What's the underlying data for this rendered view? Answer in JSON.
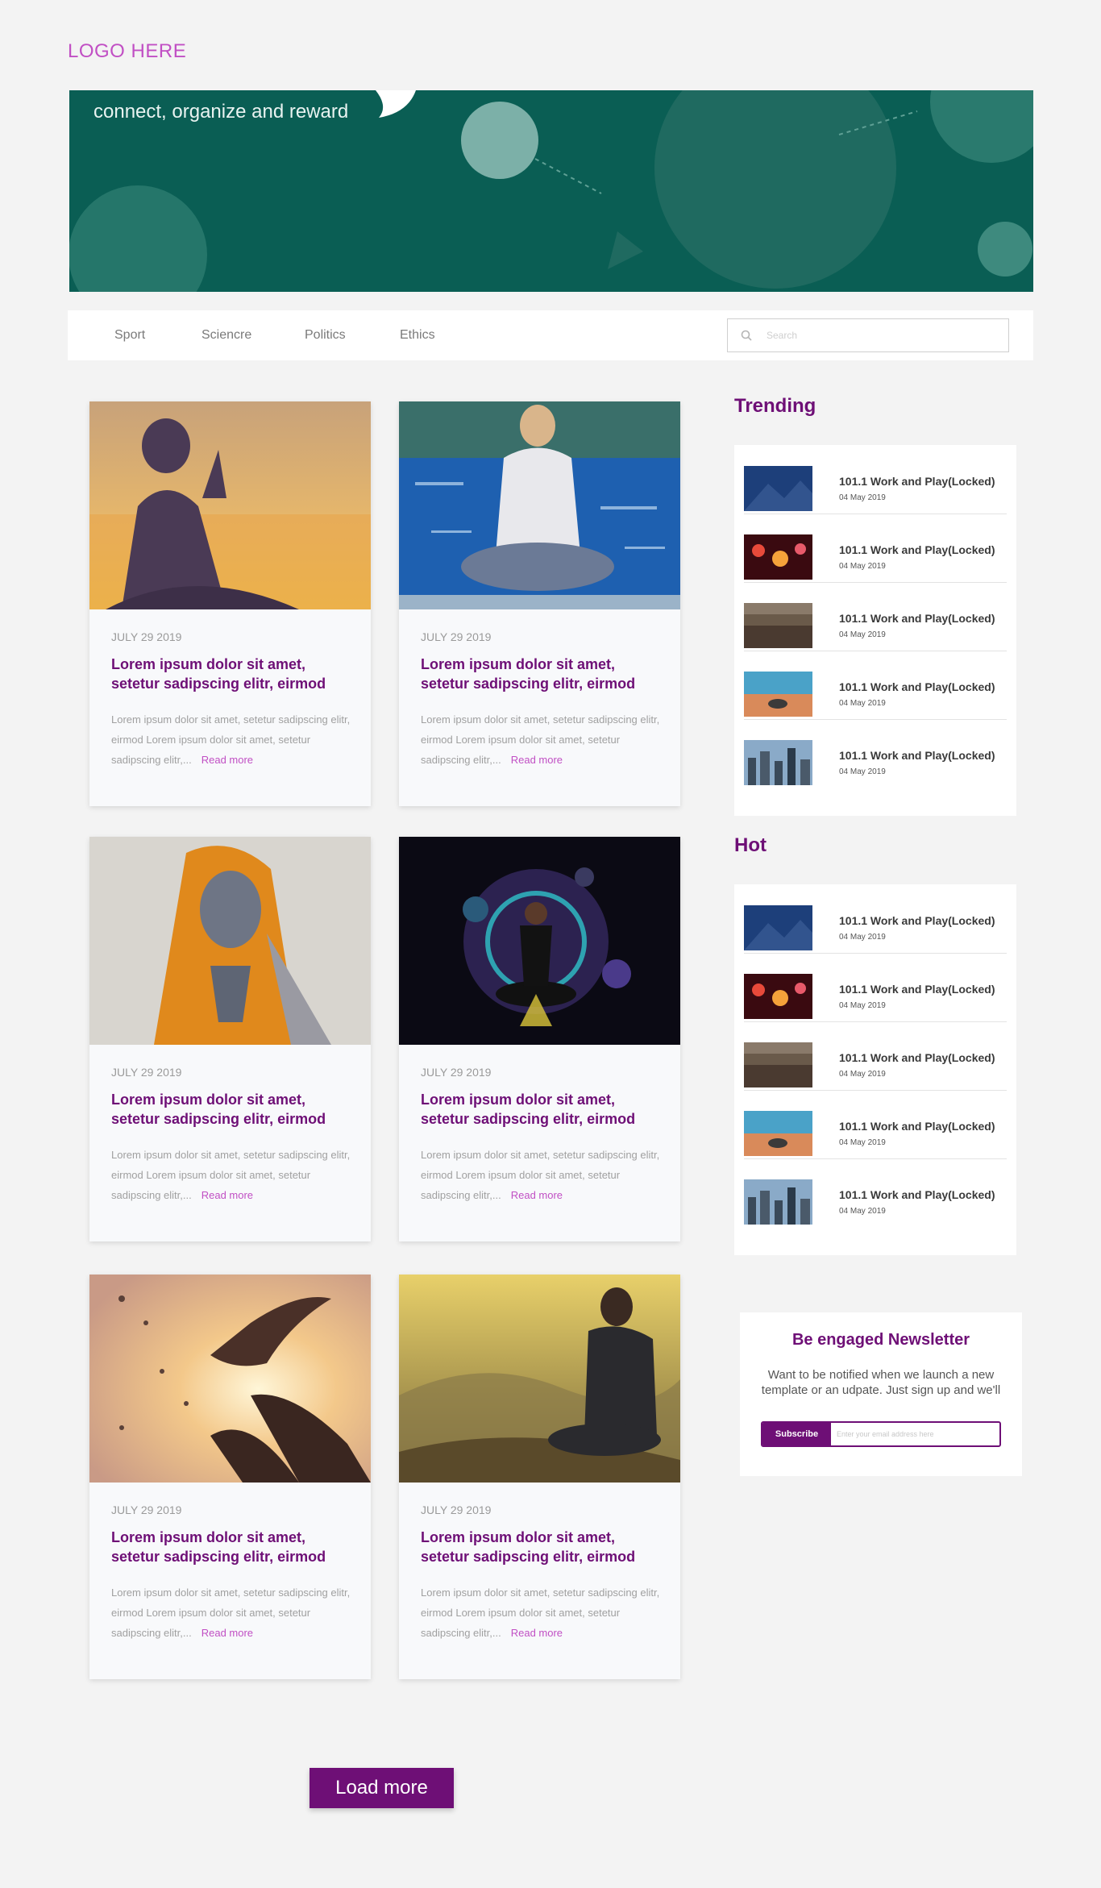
{
  "logo": "LOGO HERE",
  "hero": {
    "tagline": "connect, organize and reward"
  },
  "nav": {
    "items": [
      "Sport",
      "Sciencre",
      "Politics",
      "Ethics"
    ],
    "search_placeholder": "Search"
  },
  "posts": [
    {
      "date": "JULY 29 2019",
      "title": "Lorem ipsum dolor sit amet, setetur sadipscing elitr, eirmod",
      "excerpt": "Lorem ipsum dolor sit amet, setetur sadipscing elitr, eirmod Lorem ipsum dolor sit amet, setetur sadipscing elitr,...",
      "read_more": "Read more"
    },
    {
      "date": "JULY 29 2019",
      "title": "Lorem ipsum dolor sit amet, setetur sadipscing elitr, eirmod",
      "excerpt": "Lorem ipsum dolor sit amet, setetur sadipscing elitr, eirmod Lorem ipsum dolor sit amet, setetur sadipscing elitr,...",
      "read_more": "Read more"
    },
    {
      "date": "JULY 29 2019",
      "title": "Lorem ipsum dolor sit amet, setetur sadipscing elitr, eirmod",
      "excerpt": "Lorem ipsum dolor sit amet, setetur sadipscing elitr, eirmod Lorem ipsum dolor sit amet, setetur sadipscing elitr,...",
      "read_more": "Read more"
    },
    {
      "date": "JULY 29 2019",
      "title": "Lorem ipsum dolor sit amet, setetur sadipscing elitr, eirmod",
      "excerpt": "Lorem ipsum dolor sit amet, setetur sadipscing elitr, eirmod Lorem ipsum dolor sit amet, setetur sadipscing elitr,...",
      "read_more": "Read more"
    },
    {
      "date": "JULY 29 2019",
      "title": "Lorem ipsum dolor sit amet, setetur sadipscing elitr, eirmod",
      "excerpt": "Lorem ipsum dolor sit amet, setetur sadipscing elitr, eirmod Lorem ipsum dolor sit amet, setetur sadipscing elitr,...",
      "read_more": "Read more"
    },
    {
      "date": "JULY 29 2019",
      "title": "Lorem ipsum dolor sit amet, setetur sadipscing elitr, eirmod",
      "excerpt": "Lorem ipsum dolor sit amet, setetur sadipscing elitr, eirmod Lorem ipsum dolor sit amet, setetur sadipscing elitr,...",
      "read_more": "Read more"
    }
  ],
  "trending": {
    "heading": "Trending",
    "items": [
      {
        "title": "101.1 Work and Play(Locked)",
        "date": "04 May 2019"
      },
      {
        "title": "101.1 Work and Play(Locked)",
        "date": "04 May 2019"
      },
      {
        "title": "101.1 Work and Play(Locked)",
        "date": "04 May 2019"
      },
      {
        "title": "101.1 Work and Play(Locked)",
        "date": "04 May 2019"
      },
      {
        "title": "101.1 Work and Play(Locked)",
        "date": "04 May 2019"
      }
    ]
  },
  "hot": {
    "heading": "Hot",
    "items": [
      {
        "title": "101.1 Work and Play(Locked)",
        "date": "04 May 2019"
      },
      {
        "title": "101.1 Work and Play(Locked)",
        "date": "04 May 2019"
      },
      {
        "title": "101.1 Work and Play(Locked)",
        "date": "04 May 2019"
      },
      {
        "title": "101.1 Work and Play(Locked)",
        "date": "04 May 2019"
      },
      {
        "title": "101.1 Work and Play(Locked)",
        "date": "04 May 2019"
      }
    ]
  },
  "newsletter": {
    "heading": "Be engaged Newsletter",
    "text": "Want to be notified when we launch a new template or an udpate. Just sign up and we'll",
    "button": "Subscribe",
    "placeholder": "Enter your email address here"
  },
  "load_more": "Load more",
  "colors": {
    "brand": "#6e0f76",
    "accent": "#c14fc4",
    "hero_bg": "#0a5e54"
  }
}
